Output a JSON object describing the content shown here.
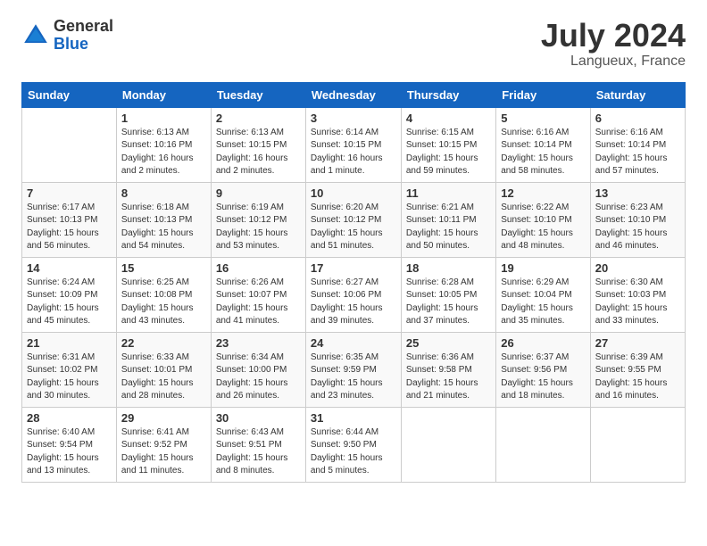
{
  "header": {
    "logo_general": "General",
    "logo_blue": "Blue",
    "title": "July 2024",
    "location": "Langueux, France"
  },
  "days_of_week": [
    "Sunday",
    "Monday",
    "Tuesday",
    "Wednesday",
    "Thursday",
    "Friday",
    "Saturday"
  ],
  "weeks": [
    [
      {
        "day": "",
        "info": ""
      },
      {
        "day": "1",
        "info": "Sunrise: 6:13 AM\nSunset: 10:16 PM\nDaylight: 16 hours\nand 2 minutes."
      },
      {
        "day": "2",
        "info": "Sunrise: 6:13 AM\nSunset: 10:15 PM\nDaylight: 16 hours\nand 2 minutes."
      },
      {
        "day": "3",
        "info": "Sunrise: 6:14 AM\nSunset: 10:15 PM\nDaylight: 16 hours\nand 1 minute."
      },
      {
        "day": "4",
        "info": "Sunrise: 6:15 AM\nSunset: 10:15 PM\nDaylight: 15 hours\nand 59 minutes."
      },
      {
        "day": "5",
        "info": "Sunrise: 6:16 AM\nSunset: 10:14 PM\nDaylight: 15 hours\nand 58 minutes."
      },
      {
        "day": "6",
        "info": "Sunrise: 6:16 AM\nSunset: 10:14 PM\nDaylight: 15 hours\nand 57 minutes."
      }
    ],
    [
      {
        "day": "7",
        "info": "Sunrise: 6:17 AM\nSunset: 10:13 PM\nDaylight: 15 hours\nand 56 minutes."
      },
      {
        "day": "8",
        "info": "Sunrise: 6:18 AM\nSunset: 10:13 PM\nDaylight: 15 hours\nand 54 minutes."
      },
      {
        "day": "9",
        "info": "Sunrise: 6:19 AM\nSunset: 10:12 PM\nDaylight: 15 hours\nand 53 minutes."
      },
      {
        "day": "10",
        "info": "Sunrise: 6:20 AM\nSunset: 10:12 PM\nDaylight: 15 hours\nand 51 minutes."
      },
      {
        "day": "11",
        "info": "Sunrise: 6:21 AM\nSunset: 10:11 PM\nDaylight: 15 hours\nand 50 minutes."
      },
      {
        "day": "12",
        "info": "Sunrise: 6:22 AM\nSunset: 10:10 PM\nDaylight: 15 hours\nand 48 minutes."
      },
      {
        "day": "13",
        "info": "Sunrise: 6:23 AM\nSunset: 10:10 PM\nDaylight: 15 hours\nand 46 minutes."
      }
    ],
    [
      {
        "day": "14",
        "info": "Sunrise: 6:24 AM\nSunset: 10:09 PM\nDaylight: 15 hours\nand 45 minutes."
      },
      {
        "day": "15",
        "info": "Sunrise: 6:25 AM\nSunset: 10:08 PM\nDaylight: 15 hours\nand 43 minutes."
      },
      {
        "day": "16",
        "info": "Sunrise: 6:26 AM\nSunset: 10:07 PM\nDaylight: 15 hours\nand 41 minutes."
      },
      {
        "day": "17",
        "info": "Sunrise: 6:27 AM\nSunset: 10:06 PM\nDaylight: 15 hours\nand 39 minutes."
      },
      {
        "day": "18",
        "info": "Sunrise: 6:28 AM\nSunset: 10:05 PM\nDaylight: 15 hours\nand 37 minutes."
      },
      {
        "day": "19",
        "info": "Sunrise: 6:29 AM\nSunset: 10:04 PM\nDaylight: 15 hours\nand 35 minutes."
      },
      {
        "day": "20",
        "info": "Sunrise: 6:30 AM\nSunset: 10:03 PM\nDaylight: 15 hours\nand 33 minutes."
      }
    ],
    [
      {
        "day": "21",
        "info": "Sunrise: 6:31 AM\nSunset: 10:02 PM\nDaylight: 15 hours\nand 30 minutes."
      },
      {
        "day": "22",
        "info": "Sunrise: 6:33 AM\nSunset: 10:01 PM\nDaylight: 15 hours\nand 28 minutes."
      },
      {
        "day": "23",
        "info": "Sunrise: 6:34 AM\nSunset: 10:00 PM\nDaylight: 15 hours\nand 26 minutes."
      },
      {
        "day": "24",
        "info": "Sunrise: 6:35 AM\nSunset: 9:59 PM\nDaylight: 15 hours\nand 23 minutes."
      },
      {
        "day": "25",
        "info": "Sunrise: 6:36 AM\nSunset: 9:58 PM\nDaylight: 15 hours\nand 21 minutes."
      },
      {
        "day": "26",
        "info": "Sunrise: 6:37 AM\nSunset: 9:56 PM\nDaylight: 15 hours\nand 18 minutes."
      },
      {
        "day": "27",
        "info": "Sunrise: 6:39 AM\nSunset: 9:55 PM\nDaylight: 15 hours\nand 16 minutes."
      }
    ],
    [
      {
        "day": "28",
        "info": "Sunrise: 6:40 AM\nSunset: 9:54 PM\nDaylight: 15 hours\nand 13 minutes."
      },
      {
        "day": "29",
        "info": "Sunrise: 6:41 AM\nSunset: 9:52 PM\nDaylight: 15 hours\nand 11 minutes."
      },
      {
        "day": "30",
        "info": "Sunrise: 6:43 AM\nSunset: 9:51 PM\nDaylight: 15 hours\nand 8 minutes."
      },
      {
        "day": "31",
        "info": "Sunrise: 6:44 AM\nSunset: 9:50 PM\nDaylight: 15 hours\nand 5 minutes."
      },
      {
        "day": "",
        "info": ""
      },
      {
        "day": "",
        "info": ""
      },
      {
        "day": "",
        "info": ""
      }
    ]
  ]
}
